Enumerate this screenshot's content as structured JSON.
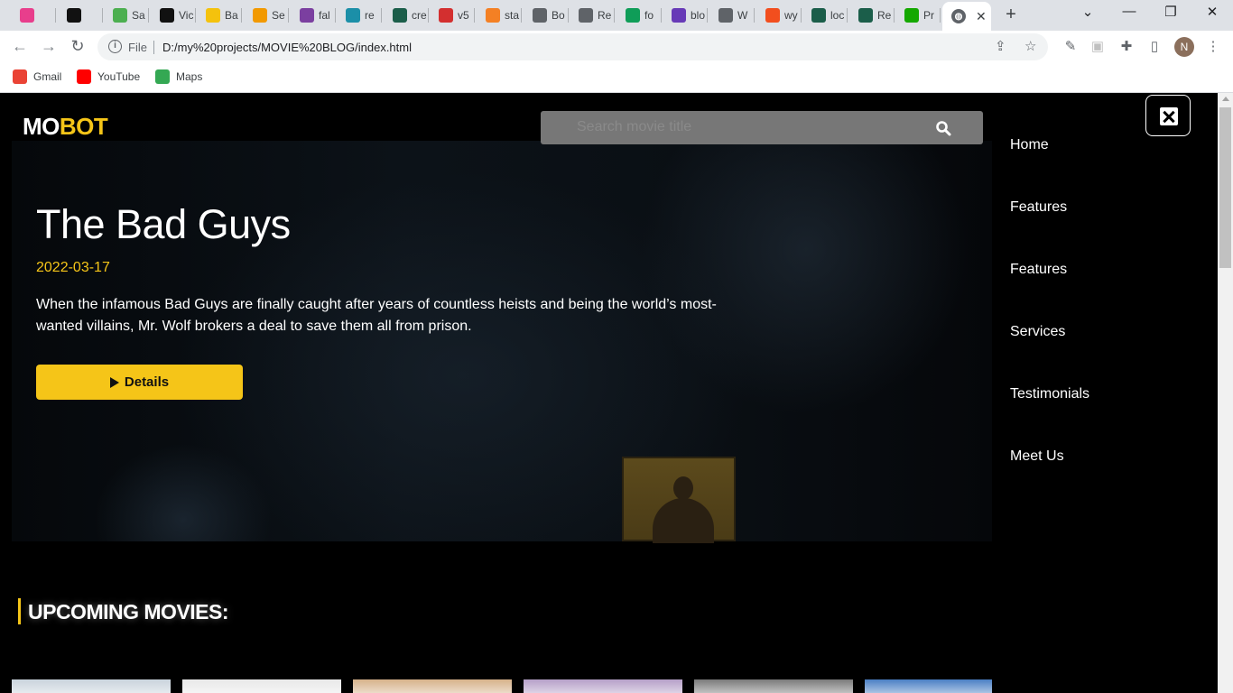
{
  "browser": {
    "tabs": [
      {
        "label": "",
        "icon": "pink-square-icon",
        "color": "#e83e8c"
      },
      {
        "label": "",
        "icon": "github-icon",
        "color": "#111111"
      },
      {
        "label": "Sa",
        "icon": "download-arrow-icon",
        "color": "#4caf50"
      },
      {
        "label": "Vic",
        "icon": "w-logo-icon",
        "color": "#111111"
      },
      {
        "label": "Ba",
        "icon": "lightning-icon",
        "color": "#f4c20d"
      },
      {
        "label": "Se",
        "icon": "orange-shapes-icon",
        "color": "#f29900"
      },
      {
        "label": "fal",
        "icon": "purple-doc-icon",
        "color": "#7b3fa0"
      },
      {
        "label": "re",
        "icon": "b-logo-icon",
        "color": "#1b8fa8"
      },
      {
        "label": "cre",
        "icon": "react-icon",
        "color": "#1b5e4a"
      },
      {
        "label": "v5",
        "icon": "dots-icon",
        "color": "#d32f2f"
      },
      {
        "label": "sta",
        "icon": "stackoverflow-icon",
        "color": "#f48024"
      },
      {
        "label": "Bo",
        "icon": "globe-icon",
        "color": "#5f6368"
      },
      {
        "label": "Re",
        "icon": "globe-icon",
        "color": "#5f6368"
      },
      {
        "label": "fo",
        "icon": "green-doc-icon",
        "color": "#0f9d58"
      },
      {
        "label": "blo",
        "icon": "rocket-icon",
        "color": "#673ab7"
      },
      {
        "label": "W",
        "icon": "globe-icon",
        "color": "#5f6368"
      },
      {
        "label": "wy",
        "icon": "figma-icon",
        "color": "#f24e1e"
      },
      {
        "label": "loc",
        "icon": "react-icon",
        "color": "#1b5e4a"
      },
      {
        "label": "Re",
        "icon": "react-icon",
        "color": "#1b5e4a"
      },
      {
        "label": "Pr",
        "icon": "upwork-icon",
        "color": "#14a800"
      }
    ],
    "active_tab": {
      "label": "",
      "icon": "globe-icon"
    },
    "address": {
      "scheme_label": "File",
      "url": "D:/my%20projects/MOVIE%20BLOG/index.html"
    },
    "profile_initial": "N",
    "bookmarks": [
      {
        "label": "Gmail",
        "icon": "gmail-icon",
        "color": "#ea4335"
      },
      {
        "label": "YouTube",
        "icon": "youtube-icon",
        "color": "#ff0000"
      },
      {
        "label": "Maps",
        "icon": "maps-icon",
        "color": "#34a853"
      }
    ]
  },
  "page": {
    "logo": {
      "part1": "MO",
      "part2": "BOT"
    },
    "search": {
      "placeholder": "Search movie title"
    },
    "hero": {
      "title": "The Bad Guys",
      "date": "2022-03-17",
      "description": "When the infamous Bad Guys are finally caught after years of countless heists and being the world’s most-wanted villains, Mr. Wolf brokers a deal to save them all from prison.",
      "button_label": "Details"
    },
    "nav": [
      "Home",
      "Features",
      "Features",
      "Services",
      "Testimonials",
      "Meet Us"
    ],
    "section_title": "UPCOMING MOVIES:",
    "posters": [
      {
        "icon": "poster-thumbnail",
        "color": "#c9d3dc"
      },
      {
        "icon": "poster-thumbnail",
        "color": "#e8e8e8"
      },
      {
        "icon": "poster-thumbnail",
        "color": "#d6b28a"
      },
      {
        "icon": "poster-thumbnail",
        "color": "#b6a0c8"
      },
      {
        "icon": "poster-thumbnail",
        "color": "#7a7a7a"
      },
      {
        "icon": "poster-thumbnail",
        "color": "#4a7fc4"
      }
    ],
    "accent_color": "#f5c518"
  }
}
